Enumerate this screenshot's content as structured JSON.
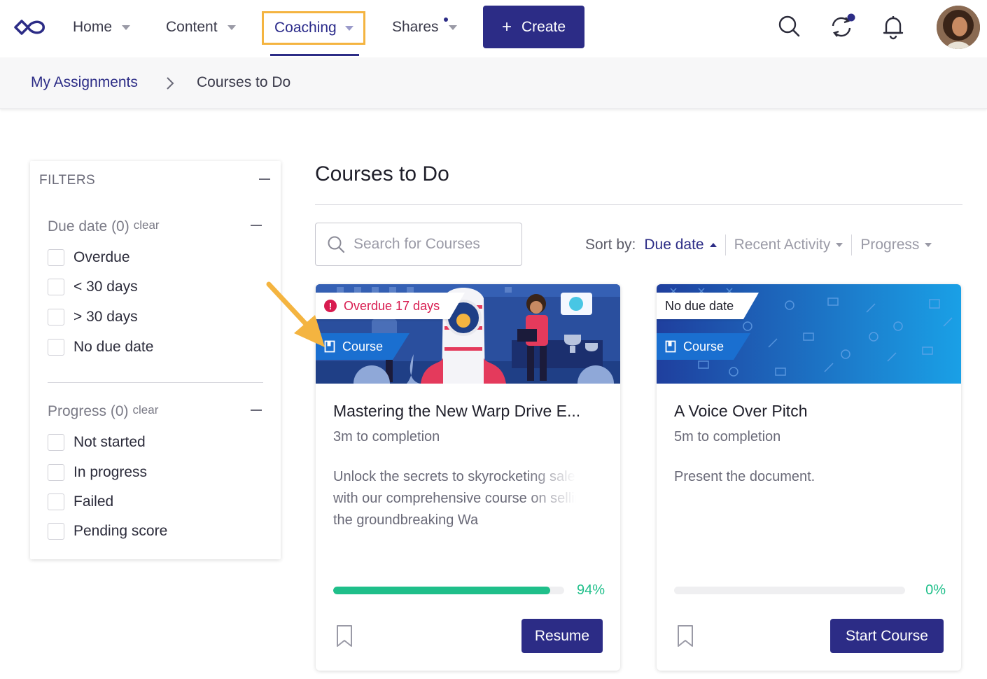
{
  "nav": {
    "home": "Home",
    "content": "Content",
    "coaching": "Coaching",
    "shares": "Shares",
    "create": "Create",
    "create_plus": "+"
  },
  "breadcrumb": {
    "parent": "My Assignments",
    "current": "Courses to Do"
  },
  "filters": {
    "title": "FILTERS",
    "groups": [
      {
        "title": "Due date (0)",
        "clear": "clear",
        "options": [
          "Overdue",
          "< 30 days",
          "> 30 days",
          "No due date"
        ]
      },
      {
        "title": "Progress (0)",
        "clear": "clear",
        "options": [
          "Not started",
          "In progress",
          "Failed",
          "Pending score"
        ]
      }
    ]
  },
  "main": {
    "title": "Courses to Do",
    "search_placeholder": "Search for Courses",
    "sort": {
      "label": "Sort by:",
      "options": [
        "Due date",
        "Recent Activity",
        "Progress"
      ],
      "active": "Due date"
    }
  },
  "cards": [
    {
      "due": "Overdue 17 days",
      "type": "Course",
      "title": "Mastering the New Warp Drive E...",
      "time": "3m to completion",
      "description": "Unlock the secrets to skyrocketing sales with our comprehensive course on selling the groundbreaking Wa",
      "progress": 0.94,
      "progress_label": "94%",
      "button": "Resume"
    },
    {
      "due": "No due date",
      "type": "Course",
      "title": "A Voice Over Pitch",
      "time": "5m to completion",
      "description": "Present the document.",
      "progress": 0,
      "progress_label": "0%",
      "button": "Start Course"
    }
  ],
  "colors": {
    "brand": "#2c2c86",
    "highlight": "#f4b440",
    "overdue": "#d81b4f",
    "progress": "#1fbf8a",
    "tag": "#1a6fd0"
  },
  "icons": [
    "logo-icon",
    "search-icon",
    "sync-icon",
    "bell-icon",
    "book-icon",
    "bookmark-icon",
    "alert-icon",
    "chevron-right-icon"
  ]
}
